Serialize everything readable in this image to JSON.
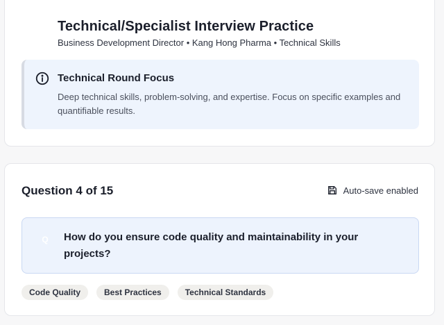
{
  "header": {
    "title": "Technical/Specialist Interview Practice",
    "subtitle": "Business Development Director • Kang Hong Pharma • Technical Skills"
  },
  "focus": {
    "icon": "info-icon",
    "title": "Technical Round Focus",
    "description": "Deep technical skills, problem-solving, and expertise. Focus on specific examples and quantifiable results."
  },
  "question": {
    "heading": "Question 4 of 15",
    "autosave_icon": "save-icon",
    "autosave_label": "Auto-save enabled",
    "icon_glyph": "Q",
    "text": "How do you ensure code quality and maintainability in your projects?",
    "tags": [
      "Code Quality",
      "Best Practices",
      "Technical Standards"
    ]
  },
  "colors": {
    "focus_bg": "#eef4fd",
    "question_bg": "#edf3fd",
    "question_border": "#c9d8f3",
    "tag_bg": "#f0efec"
  }
}
